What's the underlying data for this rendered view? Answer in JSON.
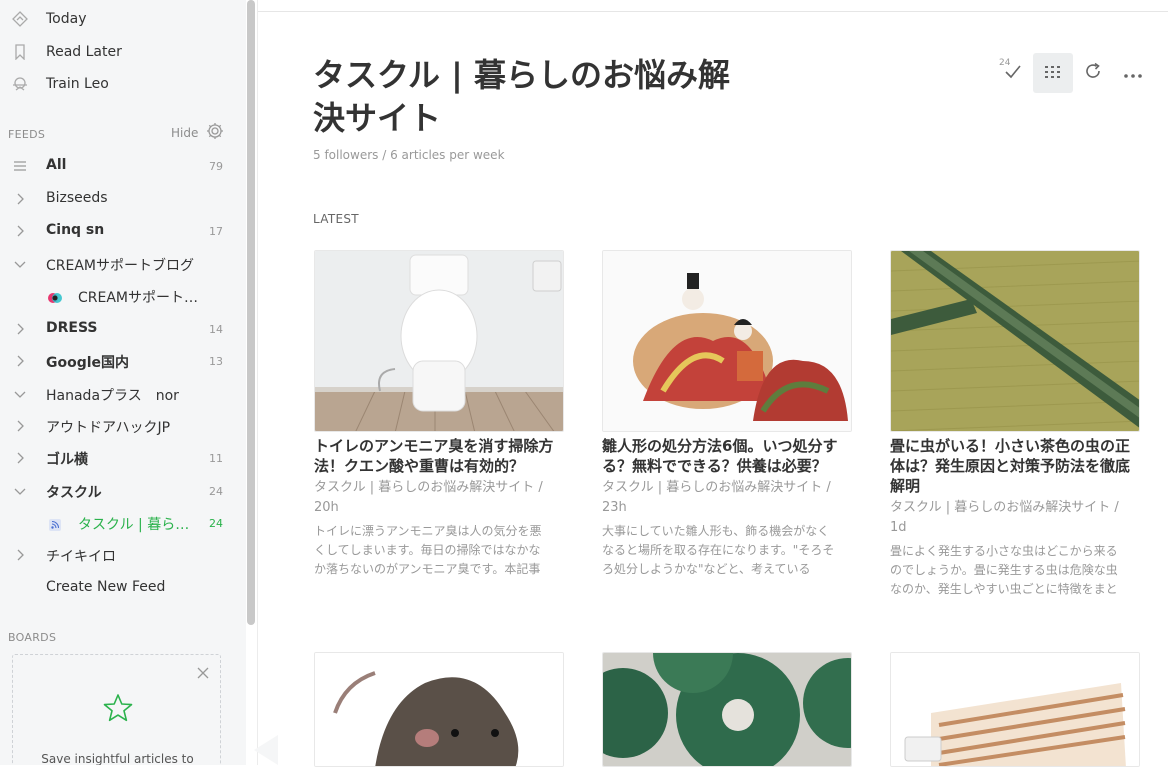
{
  "nav": {
    "today": "Today",
    "read_later": "Read Later",
    "train_leo": "Train Leo"
  },
  "feeds_section": {
    "title": "FEEDS",
    "hide": "Hide",
    "items": [
      {
        "name": "All",
        "count": "79"
      },
      {
        "name": "Bizseeds",
        "count": ""
      },
      {
        "name": "Cinq sn",
        "count": "17"
      },
      {
        "name": "CREAMサポートブログ",
        "count": ""
      },
      {
        "name": "CREAMサポート…",
        "count": ""
      },
      {
        "name": "DRESS",
        "count": "14"
      },
      {
        "name": "Google国内",
        "count": "13"
      },
      {
        "name": "Hanadaプラス　nor",
        "count": ""
      },
      {
        "name": "アウトドアハックJP",
        "count": ""
      },
      {
        "name": "ゴル横",
        "count": "11"
      },
      {
        "name": "タスクル",
        "count": "24"
      },
      {
        "name": "タスクル | 暮らし…",
        "count": "24"
      },
      {
        "name": "チイキイロ",
        "count": ""
      }
    ],
    "create_new": "Create New Feed"
  },
  "boards_section": {
    "title": "BOARDS",
    "card_text": "Save insightful articles to"
  },
  "main": {
    "title": "タスクル | 暮らしのお悩み解決サイト",
    "subinfo": "5 followers / 6 articles per week",
    "latest": "LATEST",
    "mark_read_count": "24"
  },
  "articles": [
    {
      "title": "トイレのアンモニア臭を消す掃除方法！クエン酸や重曹は有効的？",
      "source": "タスクル | 暮らしのお悩み解決サイト  /",
      "age": "20h",
      "snippet": "トイレに漂うアンモニア臭は人の気分を悪くしてしまいます。毎日の掃除ではなかなか落ちないのがアンモニア臭です。本記事"
    },
    {
      "title": "雛人形の処分方法6個。いつ処分する？無料でできる？供養は必要？",
      "source": "タスクル | 暮らしのお悩み解決サイト  /",
      "age": "23h",
      "snippet": "大事にしていた雛人形も、飾る機会がなくなると場所を取る存在になります。\"そろそろ処分しようかな\"などと、考えている"
    },
    {
      "title": "畳に虫がいる！小さい茶色の虫の正体は？発生原因と対策予防法を徹底解明",
      "source": "タスクル | 暮らしのお悩み解決サイト  /",
      "age": "1d",
      "snippet": "畳によく発生する小さな虫はどこから来るのでしょうか。畳に発生する虫は危険な虫なのか、発生しやすい虫ごとに特徴をまと"
    }
  ],
  "icons": {
    "today": "today-icon",
    "read_later": "bookmark-icon",
    "train_leo": "leo-icon",
    "settings": "gear-icon",
    "mark_read": "checkmark-icon",
    "layout": "grid-icon",
    "refresh": "refresh-icon",
    "more": "more-icon"
  },
  "colors": {
    "accent": "#2bb24c",
    "sidebar_bg": "#f5f6f7"
  }
}
